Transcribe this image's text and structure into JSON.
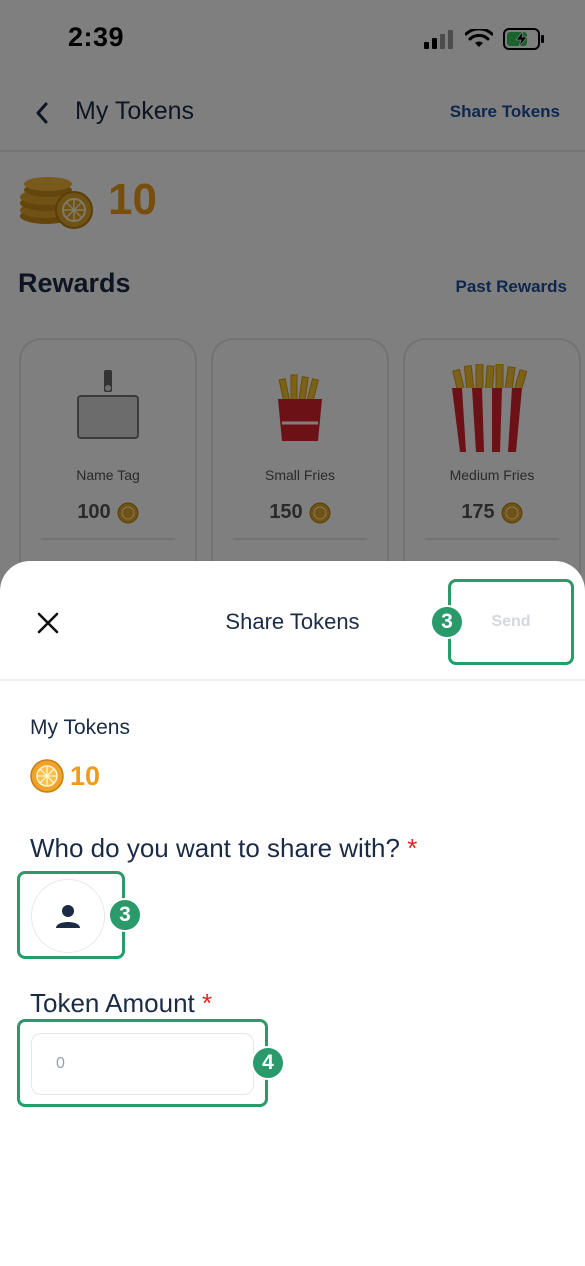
{
  "status_bar": {
    "time": "2:39"
  },
  "nav": {
    "title": "My Tokens",
    "share_link": "Share Tokens"
  },
  "balance": {
    "value": "10"
  },
  "rewards": {
    "title": "Rewards",
    "past_link": "Past Rewards",
    "items": [
      {
        "name": "Name Tag",
        "price": "100"
      },
      {
        "name": "Small Fries",
        "price": "150"
      },
      {
        "name": "Medium Fries",
        "price": "175"
      }
    ]
  },
  "sheet": {
    "title": "Share Tokens",
    "send_label": "Send",
    "my_tokens_label": "My Tokens",
    "my_tokens_value": "10",
    "who_label": "Who do you want to share with?",
    "amount_label": "Token Amount",
    "amount_placeholder": "0",
    "required_mark": "*"
  },
  "annotations": {
    "badge_send": "3",
    "badge_recipient": "3",
    "badge_amount": "4"
  },
  "colors": {
    "accent_green": "#2a9a6b",
    "token_orange": "#f19c19",
    "link_blue": "#1c4f9c",
    "required_red": "#e02424"
  }
}
